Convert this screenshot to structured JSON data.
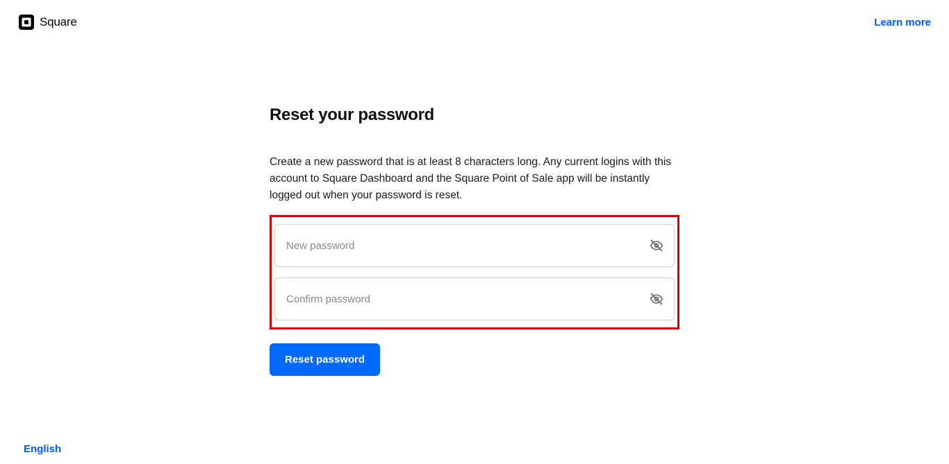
{
  "header": {
    "brand": "Square",
    "learn_more": "Learn more"
  },
  "main": {
    "title": "Reset your password",
    "description": "Create a new password that is at least 8 characters long. Any current logins with this account to Square Dashboard and the Square Point of Sale app will be instantly logged out when your password is reset.",
    "new_password_placeholder": "New password",
    "confirm_password_placeholder": "Confirm password",
    "reset_button": "Reset password"
  },
  "footer": {
    "language": "English"
  }
}
